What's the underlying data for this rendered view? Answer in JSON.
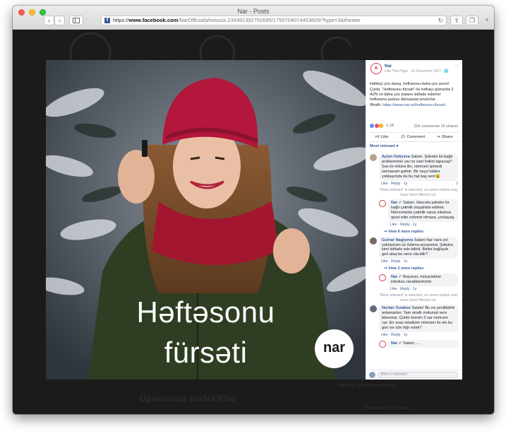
{
  "browser": {
    "window_title": "Nar - Posts",
    "url_scheme": "https://",
    "url_host": "www.facebook.com",
    "url_path": "/NarOfficial/photos/a.239381392752695/1755704074453805/?type=3&theater",
    "favicon_letter": "f"
  },
  "photo": {
    "caption_line1": "Həftəsonu",
    "caption_line2": "fürsəti",
    "logo_text": "nar"
  },
  "post": {
    "page_name": "Nar",
    "meta": "Like This Page · 15 December 2017 · 🌐",
    "text": [
      "Həftəiçi çox danış, həftəsonu daha çox sevin!",
      "Çünki, \"Həftəsonu fürsəti\" ilə həftəiçi qümərdə 2 AZN və daha çox balans istifadə edənlər həftəsonu pulsuz danışaraq sevinirlər.",
      "Ətraflı:"
    ],
    "link": "https://www.nar.az/həftəsonu-fürsəti",
    "reaction_count": "1.1K",
    "comments_shares": "216 comments  16 shares",
    "actions": {
      "like": "Like",
      "comment": "Comment",
      "share": "Share"
    },
    "sort_label": "Most relevant ▾"
  },
  "comments": [
    {
      "type": "comment",
      "author": "Aytən Hətiyeva",
      "text": "Salam. Şəbəkə ilə bağlı problemimiz var nə vaxt həllini tapacaq? Səs ilə örtünə ilin, nömrəni işinərdi isemaxam gəlmir. Bir neçə təlabə yoldaşımda da bu hal baş verir😩",
      "actions": "Like · Reply · 1y",
      "likes": "2"
    },
    {
      "type": "filtered",
      "text": "\"Most relevant\" is selected, so some replies may have been filtered out."
    },
    {
      "type": "reply",
      "author": "Nar",
      "text": "Salam. Hazırda şəbəkə ilə bağlı çətinlik müşahidə edilmir. Nömrənizdə çətinlik varsa inboksa qeyd edin zəhmət olmasa, yoxlayaq.",
      "actions": "Like · Reply · 1y"
    },
    {
      "type": "view",
      "text": "View 6 more replies"
    },
    {
      "type": "comment",
      "author": "Gulnar Nagiyeva",
      "text": "Salam Nar nara yol yükləyirəm öz ödəmə-prosesinə. Şəbəkə kimi istifadə edə bilirik. Bəlkə bağlayıb geri alaq bu nece ola bilir?",
      "actions": "Like · Reply · 1y",
      "likes": ""
    },
    {
      "type": "view",
      "text": "View 2 more replies"
    },
    {
      "type": "reply",
      "author": "Nar",
      "text": "Buyurun, müraciətiniz inboksa cavablandırıldı.",
      "actions": "Like · Reply · 1y"
    },
    {
      "type": "filtered",
      "text": "\"Most relevant\" is selected, so some replies may have been filtered out."
    },
    {
      "type": "comment",
      "author": "Nurlan Turabov",
      "text": "Salam! Bu nə yenilikdirki anlamadım. Tam ətraflı məlumat verə bilərsiniz. Çünki mənim 3 nar nömrəm var. En əsas istədiyim nömrəm ilə elə bu gün isə izlə ləğv edək?",
      "actions": "Like · Reply · 1y",
      "likes": ""
    },
    {
      "type": "reply",
      "author": "Nar",
      "text": "Salam, ...",
      "actions": ""
    }
  ],
  "write_placeholder": "Write a comment...",
  "below": {
    "left_text": "Uğurunuza tosNARlaq",
    "right_text1": "Nar Page (city mixes to you)",
    "right_text2": "The voice of our friend"
  },
  "colors": {
    "accent": "#385898",
    "nar_red": "#d23a4a",
    "page_bg": "#1b1b1b",
    "hat": "#b3173b",
    "jacket": "#2f3d22"
  }
}
